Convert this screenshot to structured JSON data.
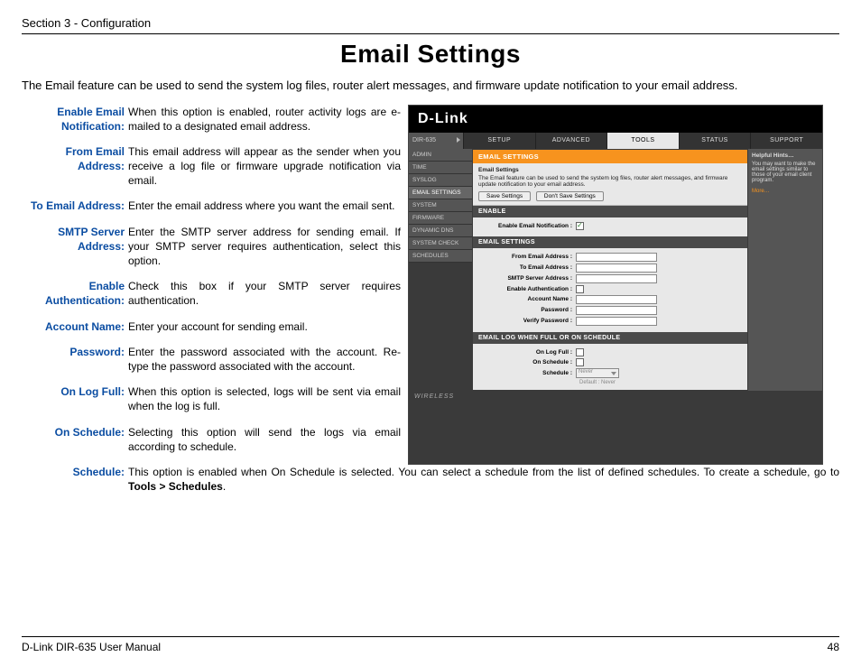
{
  "section_label": "Section 3 - Configuration",
  "page_title": "Email Settings",
  "intro": "The Email feature can be used to send the system log files, router alert messages, and firmware update notification to your email address.",
  "defs": [
    {
      "term": "Enable Email Notification:",
      "desc": "When this option is enabled, router activity logs are e-mailed to a designated email address."
    },
    {
      "term": "From Email Address:",
      "desc": "This email address will appear as the sender when you receive a log file or firmware upgrade notification via email."
    },
    {
      "term": "To Email Address:",
      "desc": "Enter the email address where you want the email sent."
    },
    {
      "term": "SMTP Server Address:",
      "desc": "Enter the SMTP server address for sending email. If your SMTP server requires authentication, select this option."
    },
    {
      "term": "Enable Authentication:",
      "desc": "Check this box if your SMTP server requires authentication."
    },
    {
      "term": "Account Name:",
      "desc": "Enter your account for sending email."
    },
    {
      "term": "Password:",
      "desc": "Enter the password associated with the account. Re-type the password associated with the account."
    },
    {
      "term": "On Log Full:",
      "desc": "When this option is selected, logs will be sent via email when the log is full."
    },
    {
      "term": "On Schedule:",
      "desc": "Selecting this option will send the logs via email according to schedule."
    }
  ],
  "schedule_def": {
    "term": "Schedule:",
    "desc_prefix": "This option is enabled when On Schedule is selected. You can select a schedule from the list of defined schedules. To create a schedule, go to ",
    "desc_bold": "Tools > Schedules",
    "desc_suffix": "."
  },
  "router": {
    "brand": "D-Link",
    "model": "DIR-635",
    "tabs": [
      "SETUP",
      "ADVANCED",
      "TOOLS",
      "STATUS",
      "SUPPORT"
    ],
    "active_tab": "TOOLS",
    "side_items": [
      "ADMIN",
      "TIME",
      "SYSLOG",
      "EMAIL SETTINGS",
      "SYSTEM",
      "FIRMWARE",
      "DYNAMIC DNS",
      "SYSTEM CHECK",
      "SCHEDULES"
    ],
    "active_side": "EMAIL SETTINGS",
    "hints_title": "Helpful Hints…",
    "hints_text": "You may want to make the email settings similar to those of your email client program.",
    "hints_more": "More…",
    "section_header": "EMAIL SETTINGS",
    "panel_title": "Email Settings",
    "panel_desc": "The Email feature can be used to send the system log files, router alert messages, and firmware update notification to your email address.",
    "btn_save": "Save Settings",
    "btn_cancel": "Don't Save Settings",
    "enable_header": "ENABLE",
    "enable_label": "Enable Email Notification :",
    "settings_header": "EMAIL SETTINGS",
    "form_labels": {
      "from": "From Email Address :",
      "to": "To Email Address :",
      "smtp": "SMTP Server Address :",
      "auth": "Enable Authentication :",
      "account": "Account Name :",
      "password": "Password :",
      "verify": "Verify Password :"
    },
    "log_header": "EMAIL LOG WHEN FULL OR ON SCHEDULE",
    "log_labels": {
      "onfull": "On Log Full :",
      "onsched": "On Schedule :",
      "sched": "Schedule :"
    },
    "select_value": "Never",
    "default_label": "Default : Never",
    "footer": "WIRELESS"
  },
  "footer_left": "D-Link DIR-635 User Manual",
  "footer_right": "48"
}
